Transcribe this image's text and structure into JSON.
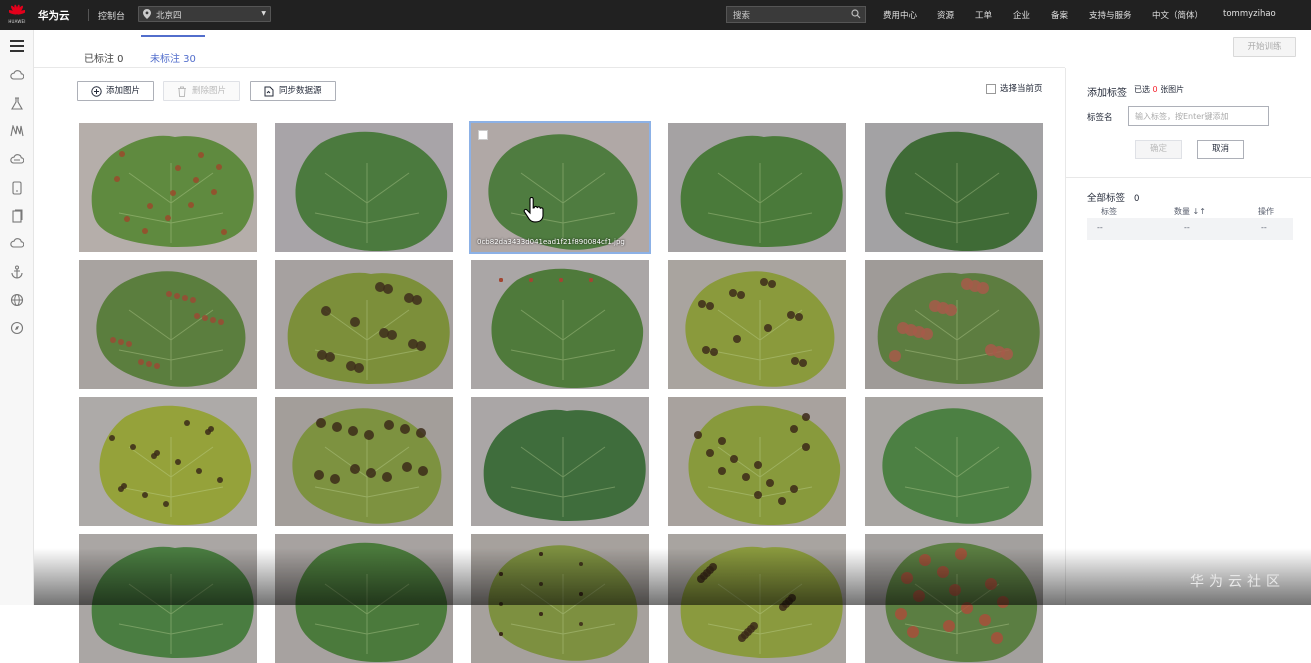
{
  "topbar": {
    "logo_text": "HUAWEI",
    "brand": "华为云",
    "console": "控制台",
    "region": "北京四",
    "search_placeholder": "搜索",
    "nav": [
      "费用中心",
      "资源",
      "工单",
      "企业",
      "备案",
      "支持与服务",
      "中文（简体）",
      "tommyzihao"
    ]
  },
  "sidebar": {
    "icons": [
      "menu-icon",
      "cloud-icon",
      "flask-icon",
      "library-icon",
      "cloud-storage-icon",
      "device-icon",
      "document-icon",
      "cloud-upload-icon",
      "anchor-icon",
      "globe-icon",
      "compass-icon"
    ]
  },
  "tabs": {
    "labeled": "已标注 0",
    "unlabeled": "未标注 30"
  },
  "toolbar": {
    "add_images": "添加图片",
    "delete_images": "删除图片",
    "sync_source": "同步数据源",
    "select_page": "选择当前页"
  },
  "train_button": "开始训练",
  "gallery": {
    "selected_filename": "0cb82da3433d041ead1f21f890084cf1.jpg",
    "images": [
      {
        "leaf": "#5f8a3f",
        "spots": "#9a4a2c",
        "bg": "#b5aeaa",
        "diseased": true
      },
      {
        "leaf": "#4b7a3e",
        "spots": "",
        "bg": "#a8a4a8",
        "diseased": false
      },
      {
        "leaf": "#4f7c40",
        "spots": "",
        "bg": "#b0a8a6",
        "diseased": false
      },
      {
        "leaf": "#4a7a3a",
        "spots": "",
        "bg": "#a5a2a3",
        "diseased": false
      },
      {
        "leaf": "#3f6b36",
        "spots": "",
        "bg": "#a3a2a4",
        "diseased": false
      },
      {
        "leaf": "#5b7e3e",
        "spots": "#9b4a34",
        "bg": "#a8a3a0",
        "diseased": true
      },
      {
        "leaf": "#7c8f3a",
        "spots": "#3e2e1c",
        "bg": "#a6a1a0",
        "diseased": true
      },
      {
        "leaf": "#4f7a3b",
        "spots": "#a24734",
        "bg": "#aaa6a6",
        "diseased": true
      },
      {
        "leaf": "#8a9a3c",
        "spots": "#3d2b1a",
        "bg": "#a9a49f",
        "diseased": true
      },
      {
        "leaf": "#5d7d40",
        "spots": "#a65a4a",
        "bg": "#9f9b98",
        "diseased": true
      },
      {
        "leaf": "#95a23a",
        "spots": "#3b2a19",
        "bg": "#adaaa8",
        "diseased": true
      },
      {
        "leaf": "#7d9240",
        "spots": "#3b2a19",
        "bg": "#a39e9a",
        "diseased": true
      },
      {
        "leaf": "#3f6d3c",
        "spots": "",
        "bg": "#aaa6a6",
        "diseased": false
      },
      {
        "leaf": "#889a3c",
        "spots": "#3c2918",
        "bg": "#a8a29e",
        "diseased": true
      },
      {
        "leaf": "#4c8043",
        "spots": "",
        "bg": "#a8a5a2",
        "diseased": false
      },
      {
        "leaf": "#4a7d41",
        "spots": "",
        "bg": "#aaa6a4",
        "diseased": false
      },
      {
        "leaf": "#4b7a3c",
        "spots": "",
        "bg": "#a7a2a0",
        "diseased": false
      },
      {
        "leaf": "#7d9040",
        "spots": "#3b2a19",
        "bg": "#a6a19d",
        "diseased": true
      },
      {
        "leaf": "#8a9a3e",
        "spots": "#3b2a19",
        "bg": "#a8a4a0",
        "diseased": true
      },
      {
        "leaf": "#5b7e42",
        "spots": "#a84f3a",
        "bg": "#a3a09e",
        "diseased": true
      }
    ]
  },
  "right_panel": {
    "add_label_title": "添加标签",
    "selected_prefix": "已选",
    "selected_count": "0",
    "selected_suffix": "张图片",
    "label_name": "标签名",
    "label_placeholder": "输入标签，按Enter键添加",
    "confirm": "确定",
    "cancel": "取消",
    "all_labels_title": "全部标签",
    "all_labels_count": "0",
    "columns": [
      "标签",
      "数量 ↓↑",
      "操作"
    ],
    "row": [
      "--",
      "--",
      "--"
    ]
  },
  "watermark": "华为云社区",
  "colors": {
    "accent": "#526ecc",
    "topbar": "#212121",
    "danger": "#f5222d"
  }
}
